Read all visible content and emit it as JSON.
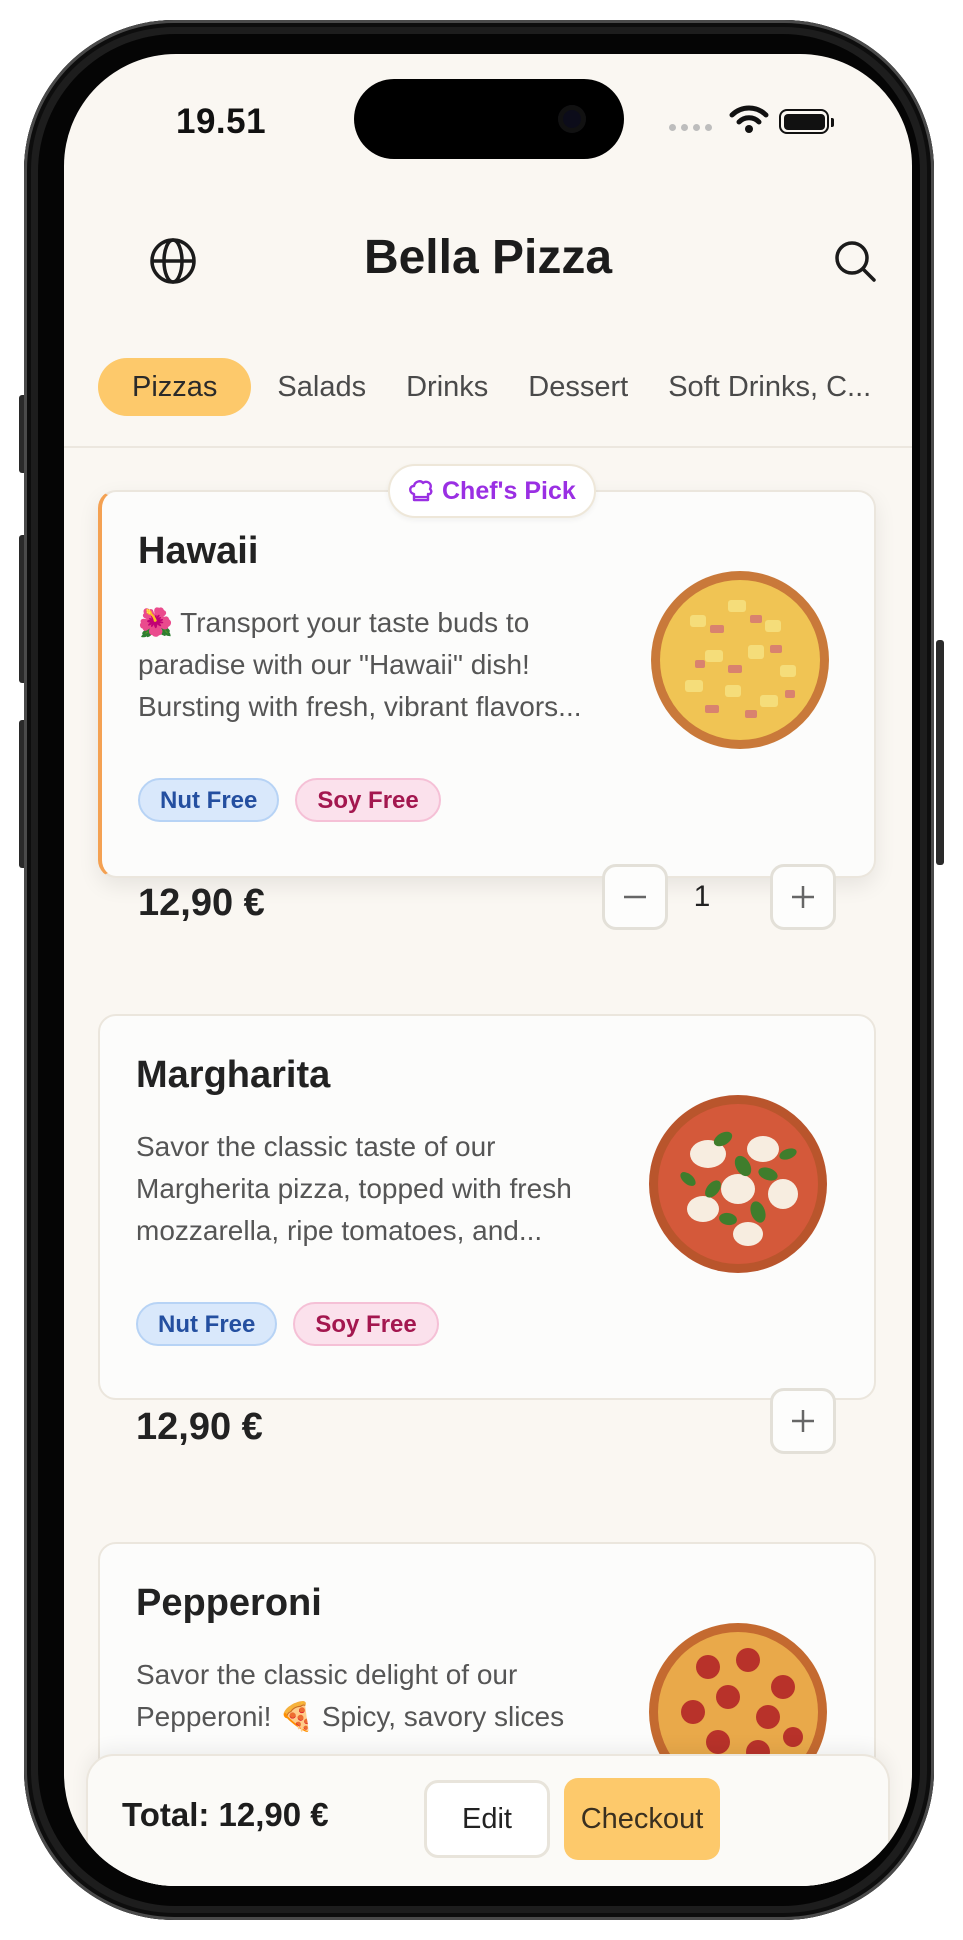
{
  "status_bar": {
    "time": "19.51"
  },
  "header": {
    "title": "Bella Pizza",
    "language_icon": "globe-icon",
    "search_icon": "search-icon"
  },
  "tabs": [
    {
      "label": "Pizzas",
      "active": true
    },
    {
      "label": "Salads"
    },
    {
      "label": "Drinks"
    },
    {
      "label": "Dessert"
    },
    {
      "label": "Soft Drinks, C..."
    }
  ],
  "chef_badge": {
    "label": "Chef's Pick",
    "icon": "chef-hat-icon",
    "color": "#9a2fe3"
  },
  "items": [
    {
      "name": "Hawaii",
      "description": "🌺 Transport your taste buds to paradise with our \"Hawaii\" dish! Bursting with fresh, vibrant flavors...",
      "tags": [
        "Nut Free",
        "Soy Free"
      ],
      "price": "12,90 €",
      "quantity": "1"
    },
    {
      "name": "Margharita",
      "description": "Savor the classic taste of our Margherita pizza, topped with fresh mozzarella, ripe tomatoes, and...",
      "tags": [
        "Nut Free",
        "Soy Free"
      ],
      "price": "12,90 €"
    },
    {
      "name": "Pepperoni",
      "description": "Savor the classic delight of our Pepperoni! 🍕 Spicy, savory slices"
    }
  ],
  "footer": {
    "total": "Total: 12,90 €",
    "edit_label": "Edit",
    "checkout_label": "Checkout"
  },
  "colors": {
    "accent": "#fdc96b",
    "featured_border": "#f4a152",
    "background": "#faf7f2"
  }
}
